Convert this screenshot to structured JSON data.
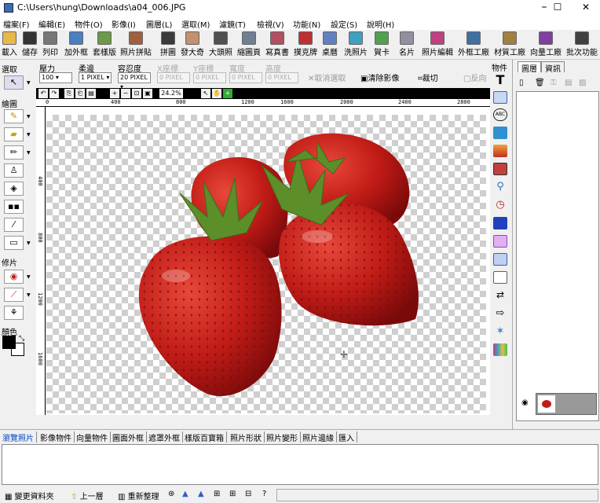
{
  "window": {
    "title": "C:\\Users\\hung\\Downloads\\a04_006.JPG",
    "minimize": "–",
    "maximize": "☐",
    "close": "✕"
  },
  "menu": [
    "檔案(F)",
    "編輯(E)",
    "物件(O)",
    "影像(I)",
    "圖層(L)",
    "選取(M)",
    "濾鏡(T)",
    "檢視(V)",
    "功能(N)",
    "設定(S)",
    "說明(H)"
  ],
  "toolbar": [
    {
      "label": "載入",
      "icon": "folder-open-icon",
      "color": "#e8b84a"
    },
    {
      "label": "儲存",
      "icon": "save-icon",
      "color": "#333333"
    },
    {
      "label": "列印",
      "icon": "printer-icon",
      "color": "#777777"
    },
    {
      "label": "加外框",
      "icon": "frame-icon",
      "color": "#4a7fc0"
    },
    {
      "label": "套樣版",
      "icon": "template-icon",
      "color": "#6a9a4a"
    },
    {
      "label": "照片拼貼",
      "icon": "collage-icon",
      "color": "#a06040"
    },
    {
      "label": "拼圖",
      "icon": "puzzle-icon",
      "color": "#3a3a3a"
    },
    {
      "label": "發大奇",
      "icon": "face-icon",
      "color": "#c09070"
    },
    {
      "label": "大頭照",
      "icon": "id-photo-icon",
      "color": "#505050"
    },
    {
      "label": "縮圖頁",
      "icon": "thumbnail-icon",
      "color": "#708090"
    },
    {
      "label": "寫真書",
      "icon": "photobook-icon",
      "color": "#b05060"
    },
    {
      "label": "撲克牌",
      "icon": "cards-icon",
      "color": "#c03030"
    },
    {
      "label": "桌曆",
      "icon": "calendar-icon",
      "color": "#6080c0"
    },
    {
      "label": "洗照片",
      "icon": "print-photo-icon",
      "color": "#40a0c0"
    },
    {
      "label": "賀卡",
      "icon": "greeting-card-icon",
      "color": "#50a050"
    },
    {
      "label": "名片",
      "icon": "business-card-icon",
      "color": "#9090a0"
    },
    {
      "label": "照片編輯",
      "icon": "photo-edit-icon",
      "color": "#c04080"
    },
    {
      "label": "外框工廠",
      "icon": "frame-factory-icon",
      "color": "#4070a0"
    },
    {
      "label": "材質工廠",
      "icon": "texture-factory-icon",
      "color": "#a08040"
    },
    {
      "label": "向量工廠",
      "icon": "vector-factory-icon",
      "color": "#8040a0"
    },
    {
      "label": "批次功能",
      "icon": "batch-icon",
      "color": "#404040"
    }
  ],
  "left_panel": {
    "select_label": "選取",
    "draw_label": "繪圖",
    "retouch_label": "修片",
    "color_label": "顏色",
    "primary_color": "#000000",
    "secondary_color": "#ffffff"
  },
  "props": {
    "opacity_label": "壓力",
    "opacity_value": "100",
    "feather_label": "柔邊",
    "feather_value": "1",
    "tolerance_label": "容忍度",
    "tolerance_value": "20",
    "x_label": "X座標",
    "x_value": "0",
    "y_label": "Y座標",
    "y_value": "0",
    "w_label": "寬度",
    "w_value": "0",
    "h_label": "高度",
    "h_value": "0",
    "cancel_select": "取消選取",
    "clear_image": "清除影像",
    "crop": "裁切",
    "invert": "反向"
  },
  "view": {
    "zoom": "24.2%"
  },
  "ruler": {
    "h_ticks": [
      "0",
      "400",
      "800",
      "1200",
      "1600",
      "2000",
      "2400",
      "2800"
    ],
    "v_ticks": [
      "400",
      "800",
      "1200",
      "1600"
    ]
  },
  "right_panel": {
    "strip_label": "物件",
    "tabs": [
      "圖層",
      "資訊"
    ],
    "tools": [
      {
        "icon": "text-icon",
        "color": "#000000"
      },
      {
        "icon": "wordart-icon",
        "color": "#4060c0"
      },
      {
        "icon": "abc-stamp-icon",
        "color": "#202020"
      },
      {
        "icon": "image-object-icon",
        "color": "#3090d0"
      },
      {
        "icon": "sunset-icon",
        "color": "#d06030"
      },
      {
        "icon": "photo-stack-icon",
        "color": "#c04040"
      },
      {
        "icon": "magnifier-icon",
        "color": "#3070c0"
      },
      {
        "icon": "clock-icon",
        "color": "#c02020"
      },
      {
        "icon": "sticker-icon",
        "color": "#2040c0"
      },
      {
        "icon": "cake-icon",
        "color": "#a040c0"
      },
      {
        "icon": "calendar-small-icon",
        "color": "#4060a0"
      },
      {
        "icon": "speech-bubble-icon",
        "color": "#606060"
      },
      {
        "icon": "double-arrow-icon",
        "color": "#303030"
      },
      {
        "icon": "arrow-icon",
        "color": "#303030"
      },
      {
        "icon": "star-burst-icon",
        "color": "#4080c0"
      },
      {
        "icon": "color-grid-icon",
        "color": "#c04080"
      }
    ]
  },
  "bottom_tabs": [
    "瀏覽照片",
    "影像物件",
    "向量物件",
    "圖面外框",
    "遮罩外框",
    "樣版百寶箱",
    "照片形狀",
    "照片變形",
    "照片邊緣",
    "匯入"
  ],
  "status": {
    "change_folder": "變更資料夾",
    "up_level": "上一層",
    "refresh": "重新整理"
  }
}
